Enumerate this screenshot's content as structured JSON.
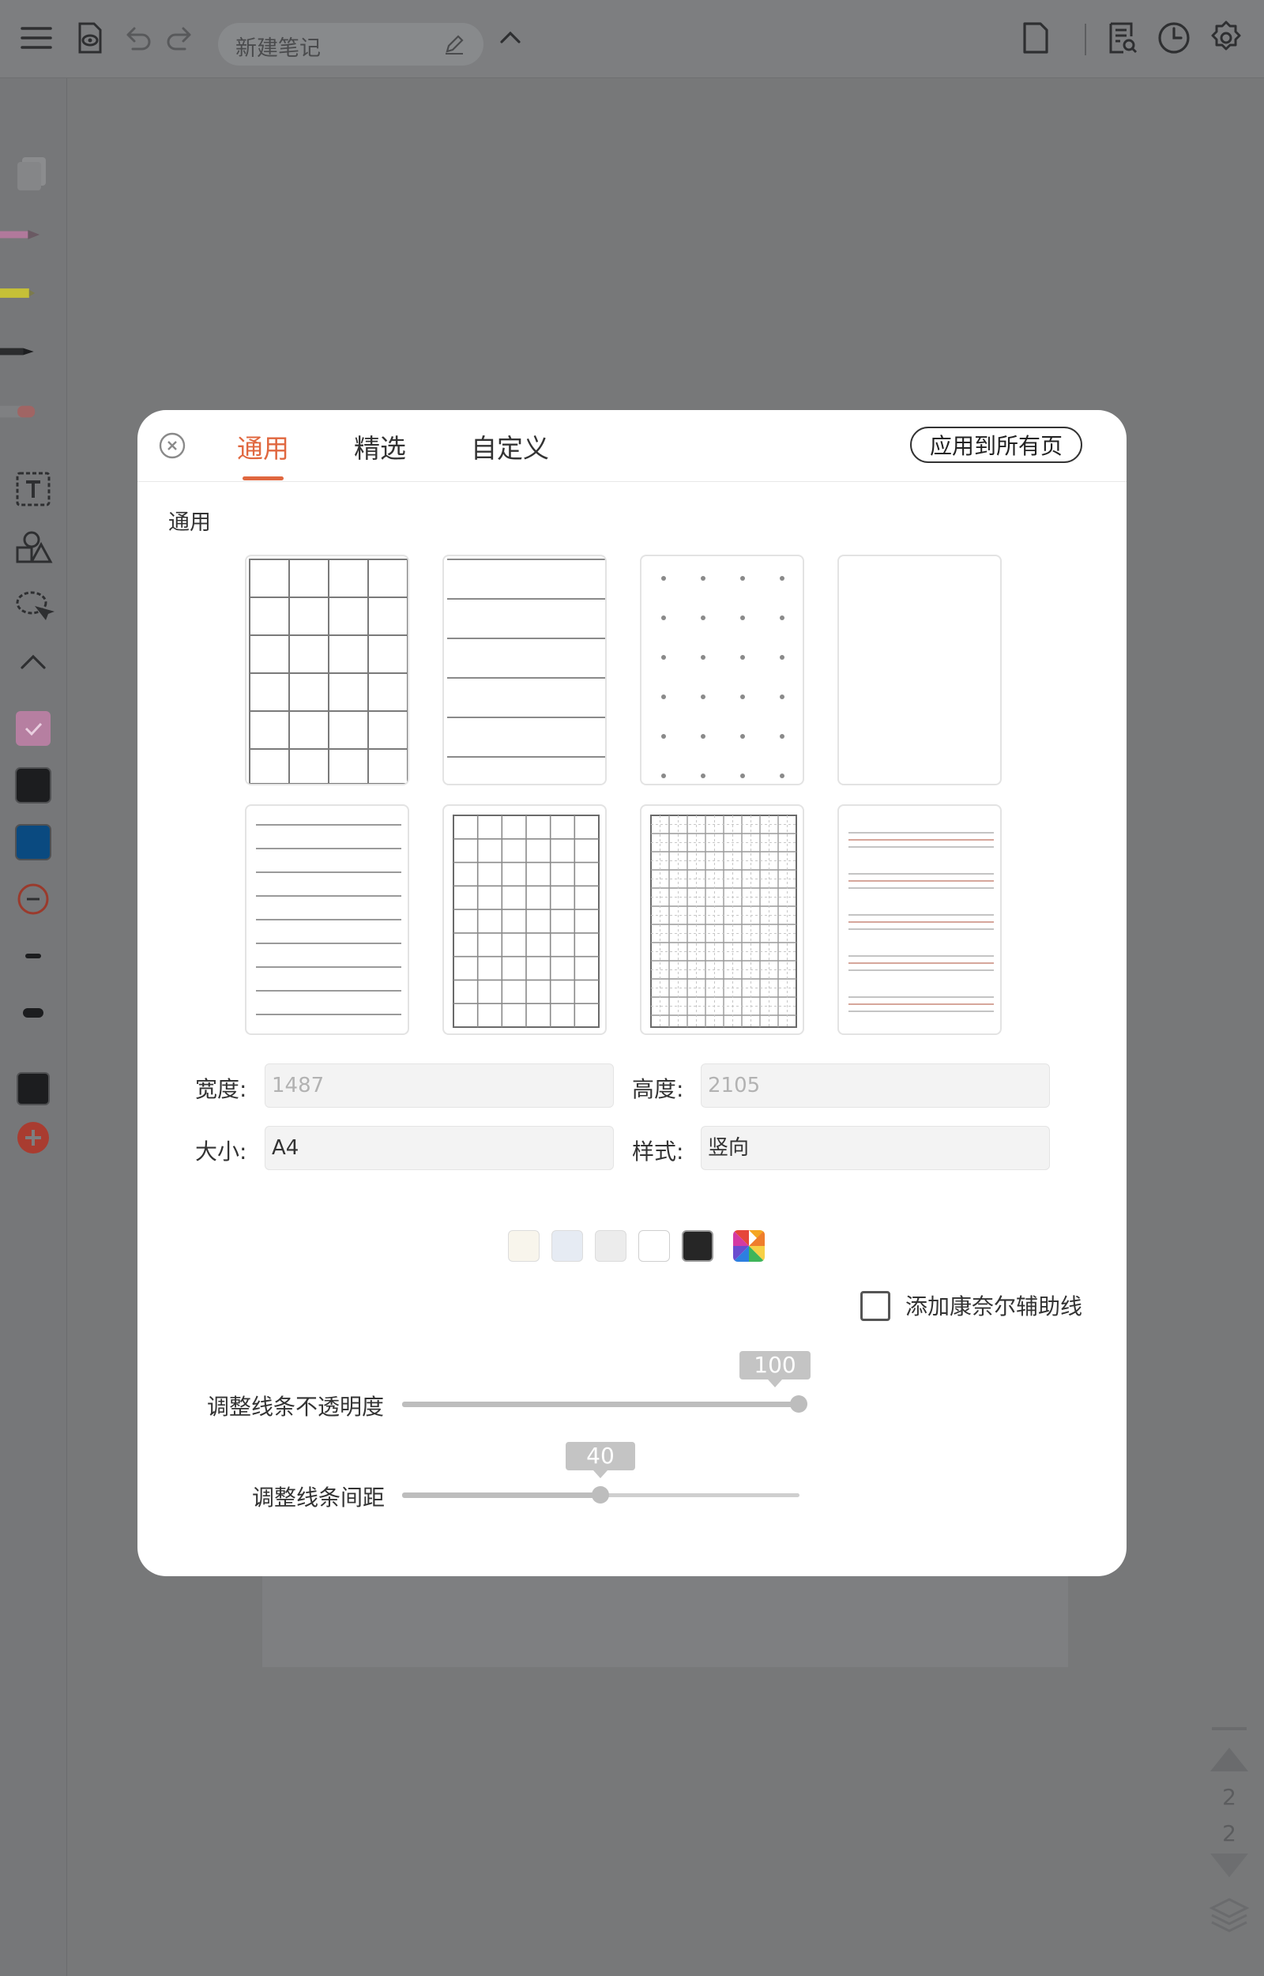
{
  "topbar": {
    "note_title": "新建笔记",
    "icons": [
      "menu-icon",
      "preview-icon",
      "undo-icon",
      "redo-icon",
      "edit-title-icon",
      "collapse-up-icon",
      "page-icon",
      "search-doc-icon",
      "history-icon",
      "settings-icon"
    ]
  },
  "pagenav": {
    "current": "2",
    "total": "2"
  },
  "dialog": {
    "tabs": [
      {
        "label": "通用",
        "active": true
      },
      {
        "label": "精选",
        "active": false
      },
      {
        "label": "自定义",
        "active": false
      }
    ],
    "apply_all_label": "应用到所有页",
    "section_title": "通用",
    "templates": [
      "grid-large",
      "lines",
      "dots",
      "blank",
      "narrow-lines",
      "grid-medium",
      "grid-dense",
      "english-lines"
    ],
    "width_label": "宽度:",
    "width_value": "1487",
    "height_label": "高度:",
    "height_value": "2105",
    "size_label": "大小:",
    "size_value": "A4",
    "style_label": "样式:",
    "style_value": "竖向",
    "swatches": [
      "#f8f5ec",
      "#e6ebf3",
      "#ececec",
      "#ffffff",
      "#262626",
      "multicolor"
    ],
    "cornell_label": "添加康奈尔辅助线",
    "cornell_checked": false,
    "opacity": {
      "label": "调整线条不透明度",
      "value": "100",
      "fraction": 1.0
    },
    "spacing": {
      "label": "调整线条间距",
      "value": "40",
      "fraction": 0.5
    },
    "accent_color": "#e0673f"
  }
}
